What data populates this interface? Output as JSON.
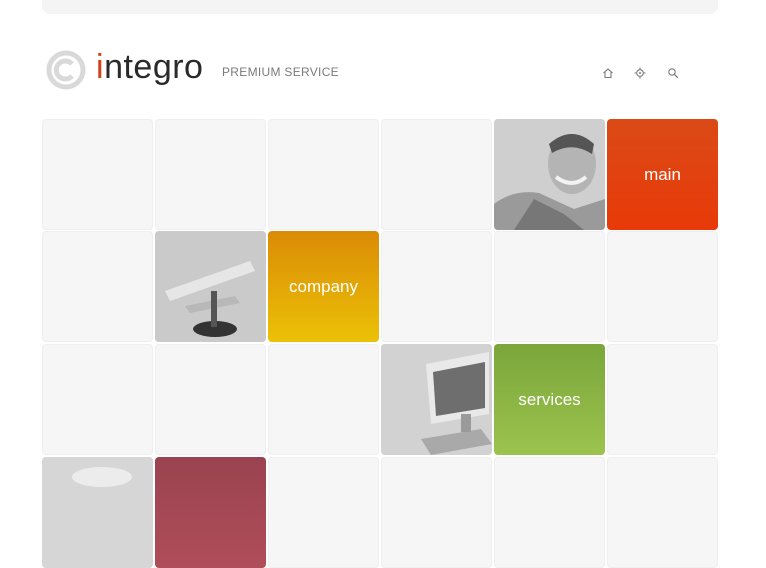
{
  "header": {
    "logo_initial": "i",
    "logo_rest": "ntegro",
    "tagline": "PREMIUM SERVICE"
  },
  "nav_icons": [
    "home-icon",
    "target-icon",
    "search-icon"
  ],
  "tiles": {
    "main_label": "main",
    "company_label": "company",
    "services_label": "services"
  },
  "colors": {
    "accent_red": "#e23d0e",
    "accent_orange": "#e4a506",
    "accent_green": "#8bb545",
    "accent_maroon": "#a54854"
  }
}
